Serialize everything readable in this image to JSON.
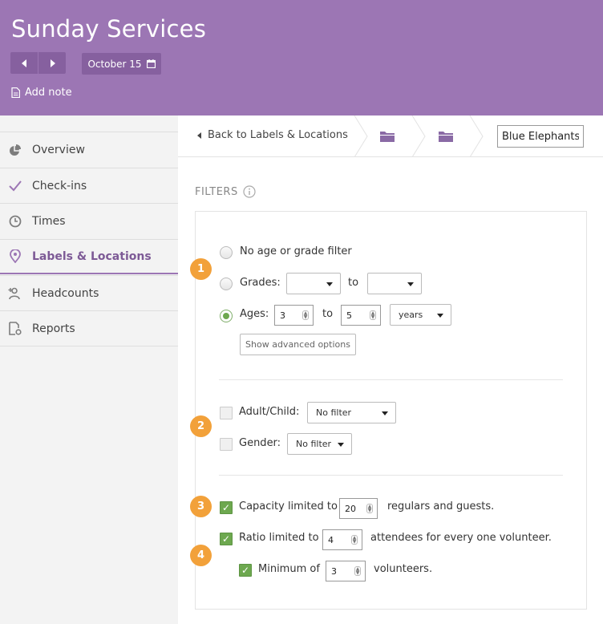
{
  "header": {
    "title": "Sunday Services",
    "date_label": "October 15",
    "add_note_label": "Add note"
  },
  "sidebar": {
    "items": [
      {
        "label": "Overview",
        "icon": "pie-chart-icon"
      },
      {
        "label": "Check-ins",
        "icon": "checkmark-icon"
      },
      {
        "label": "Times",
        "icon": "clock-icon"
      },
      {
        "label": "Labels & Locations",
        "icon": "map-pin-icon",
        "active": true
      },
      {
        "label": "Headcounts",
        "icon": "add-person-icon"
      },
      {
        "label": "Reports",
        "icon": "report-settings-icon"
      }
    ]
  },
  "breadcrumb": {
    "back_label": "Back to Labels & Locations",
    "location_name": "Blue Elephants"
  },
  "filters": {
    "heading": "FILTERS",
    "no_filter_label": "No age or grade filter",
    "grades_label": "Grades:",
    "grades_to": "to",
    "grades_from_value": "",
    "grades_to_value": "",
    "ages_label": "Ages:",
    "ages_from": "3",
    "ages_to_label": "to",
    "ages_to": "5",
    "ages_unit": "years",
    "advanced_label": "Show advanced options",
    "adult_child_label": "Adult/Child:",
    "adult_child_value": "No filter",
    "gender_label": "Gender:",
    "gender_value": "No filter",
    "capacity_prefix": "Capacity limited to",
    "capacity_value": "20",
    "capacity_suffix": "regulars and guests.",
    "ratio_prefix": "Ratio limited to",
    "ratio_value": "4",
    "ratio_suffix": "attendees for every one volunteer.",
    "minimum_prefix": "Minimum of",
    "minimum_value": "3",
    "minimum_suffix": "volunteers."
  },
  "badges": [
    "1",
    "2",
    "3",
    "4"
  ],
  "colors": {
    "header": "#9c76b4",
    "accent_green": "#6da84f",
    "badge_orange": "#f2a13a"
  }
}
